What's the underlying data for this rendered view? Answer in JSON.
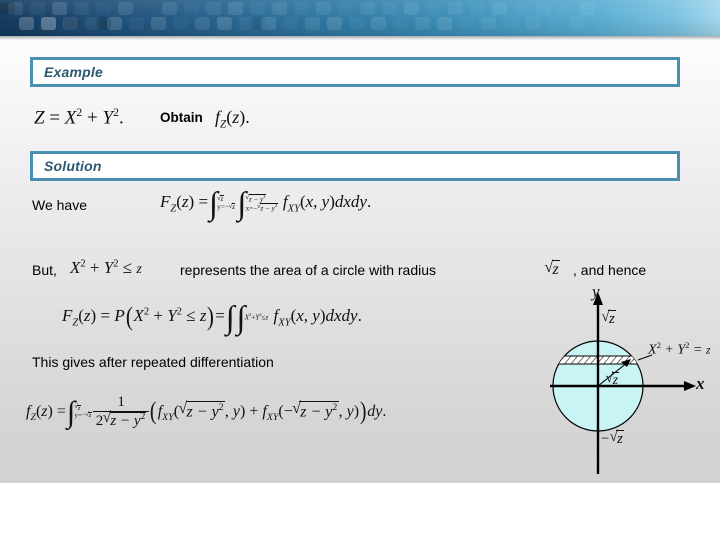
{
  "slide": {
    "example_heading": "Example",
    "solution_heading": "Solution",
    "problem_text_obtain": "Obtain",
    "we_have_label": "We have",
    "but_label": "But,",
    "represents_text": "represents the area of a circle with radius",
    "and_hence_text": ", and hence",
    "this_gives_text": "This gives after repeated differentiation"
  },
  "math": {
    "Z": "Z",
    "eq": "=",
    "X": "X",
    "Y": "Y",
    "plus": "+",
    "two_sup": "2",
    "period": ".",
    "f": "f",
    "F": "F",
    "P": "P",
    "sub_Z": "Z",
    "sub_XY": "XY",
    "z": "z",
    "y": "y",
    "x": "x",
    "le": "≤",
    "minus": "−",
    "dxdy": "dxdy",
    "dy": "dy",
    "comma": ",",
    "one": "1",
    "two": "2",
    "y_eq": "y=",
    "x_eq": "x=",
    "z_minus_y2": "z − y",
    "open_paren": "(",
    "close_paren": ")",
    "integral": "∫"
  },
  "diagram": {
    "axis_x_label": "x",
    "axis_y_label": "y",
    "top_tick_label": "√z",
    "bottom_tick_label": "−√z",
    "radius_label": "√z",
    "circle_equation": "X² + Y² = z",
    "circle_fill": "#c9f4f6",
    "circle_stroke": "#000000",
    "axis_color": "#000000",
    "strip_fill": "#ffffff"
  },
  "theme": {
    "banner_dark": "#12395e",
    "banner_light": "#a5d8ef",
    "box_border": "#4a8fb2",
    "heading_text": "#2c5871",
    "body_bg_top": "#fdfdfd",
    "body_bg_bottom": "#d3d3d3"
  }
}
